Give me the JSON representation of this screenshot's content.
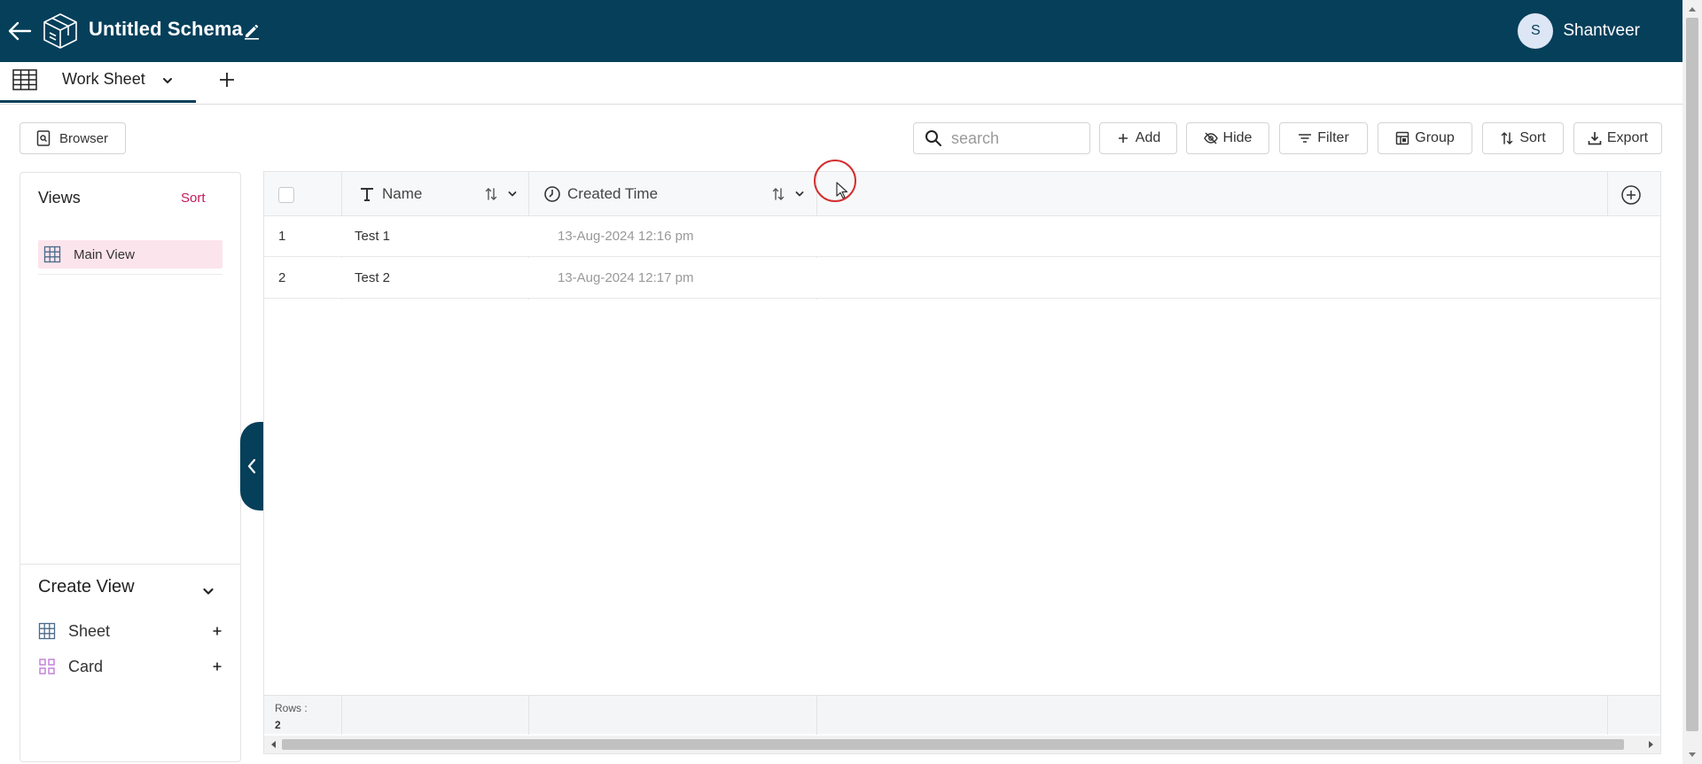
{
  "header": {
    "title": "Untitled Schema",
    "user": {
      "initial": "S",
      "name": "Shantveer"
    },
    "background": "#053f5a"
  },
  "tabs": [
    {
      "label": "Work Sheet",
      "active": true
    }
  ],
  "toolbar": {
    "browser_label": "Browser",
    "search_placeholder": "search",
    "search_value": "",
    "add_label": "Add",
    "hide_label": "Hide",
    "filter_label": "Filter",
    "group_label": "Group",
    "sort_label": "Sort",
    "export_label": "Export"
  },
  "views": {
    "title": "Views",
    "sort_label": "Sort",
    "items": [
      {
        "label": "Main View",
        "selected": true
      }
    ]
  },
  "create_view": {
    "title": "Create View",
    "items": [
      {
        "label": "Sheet",
        "icon": "grid-icon"
      },
      {
        "label": "Card",
        "icon": "card-grid-icon"
      }
    ]
  },
  "table": {
    "columns": [
      {
        "label": "Name",
        "icon": "text-type-icon"
      },
      {
        "label": "Created Time",
        "icon": "clock-icon"
      }
    ],
    "rows": [
      {
        "index": "1",
        "name": "Test 1",
        "created": "13-Aug-2024 12:16 pm"
      },
      {
        "index": "2",
        "name": "Test 2",
        "created": "13-Aug-2024 12:17 pm"
      }
    ],
    "footer": {
      "rows_label": "Rows :",
      "rows_count": "2"
    }
  },
  "colors": {
    "accent": "#053f5a",
    "sort_link": "#c2185b",
    "selected_view_bg": "#fce4ec",
    "card_icon": "#c17bd6"
  }
}
